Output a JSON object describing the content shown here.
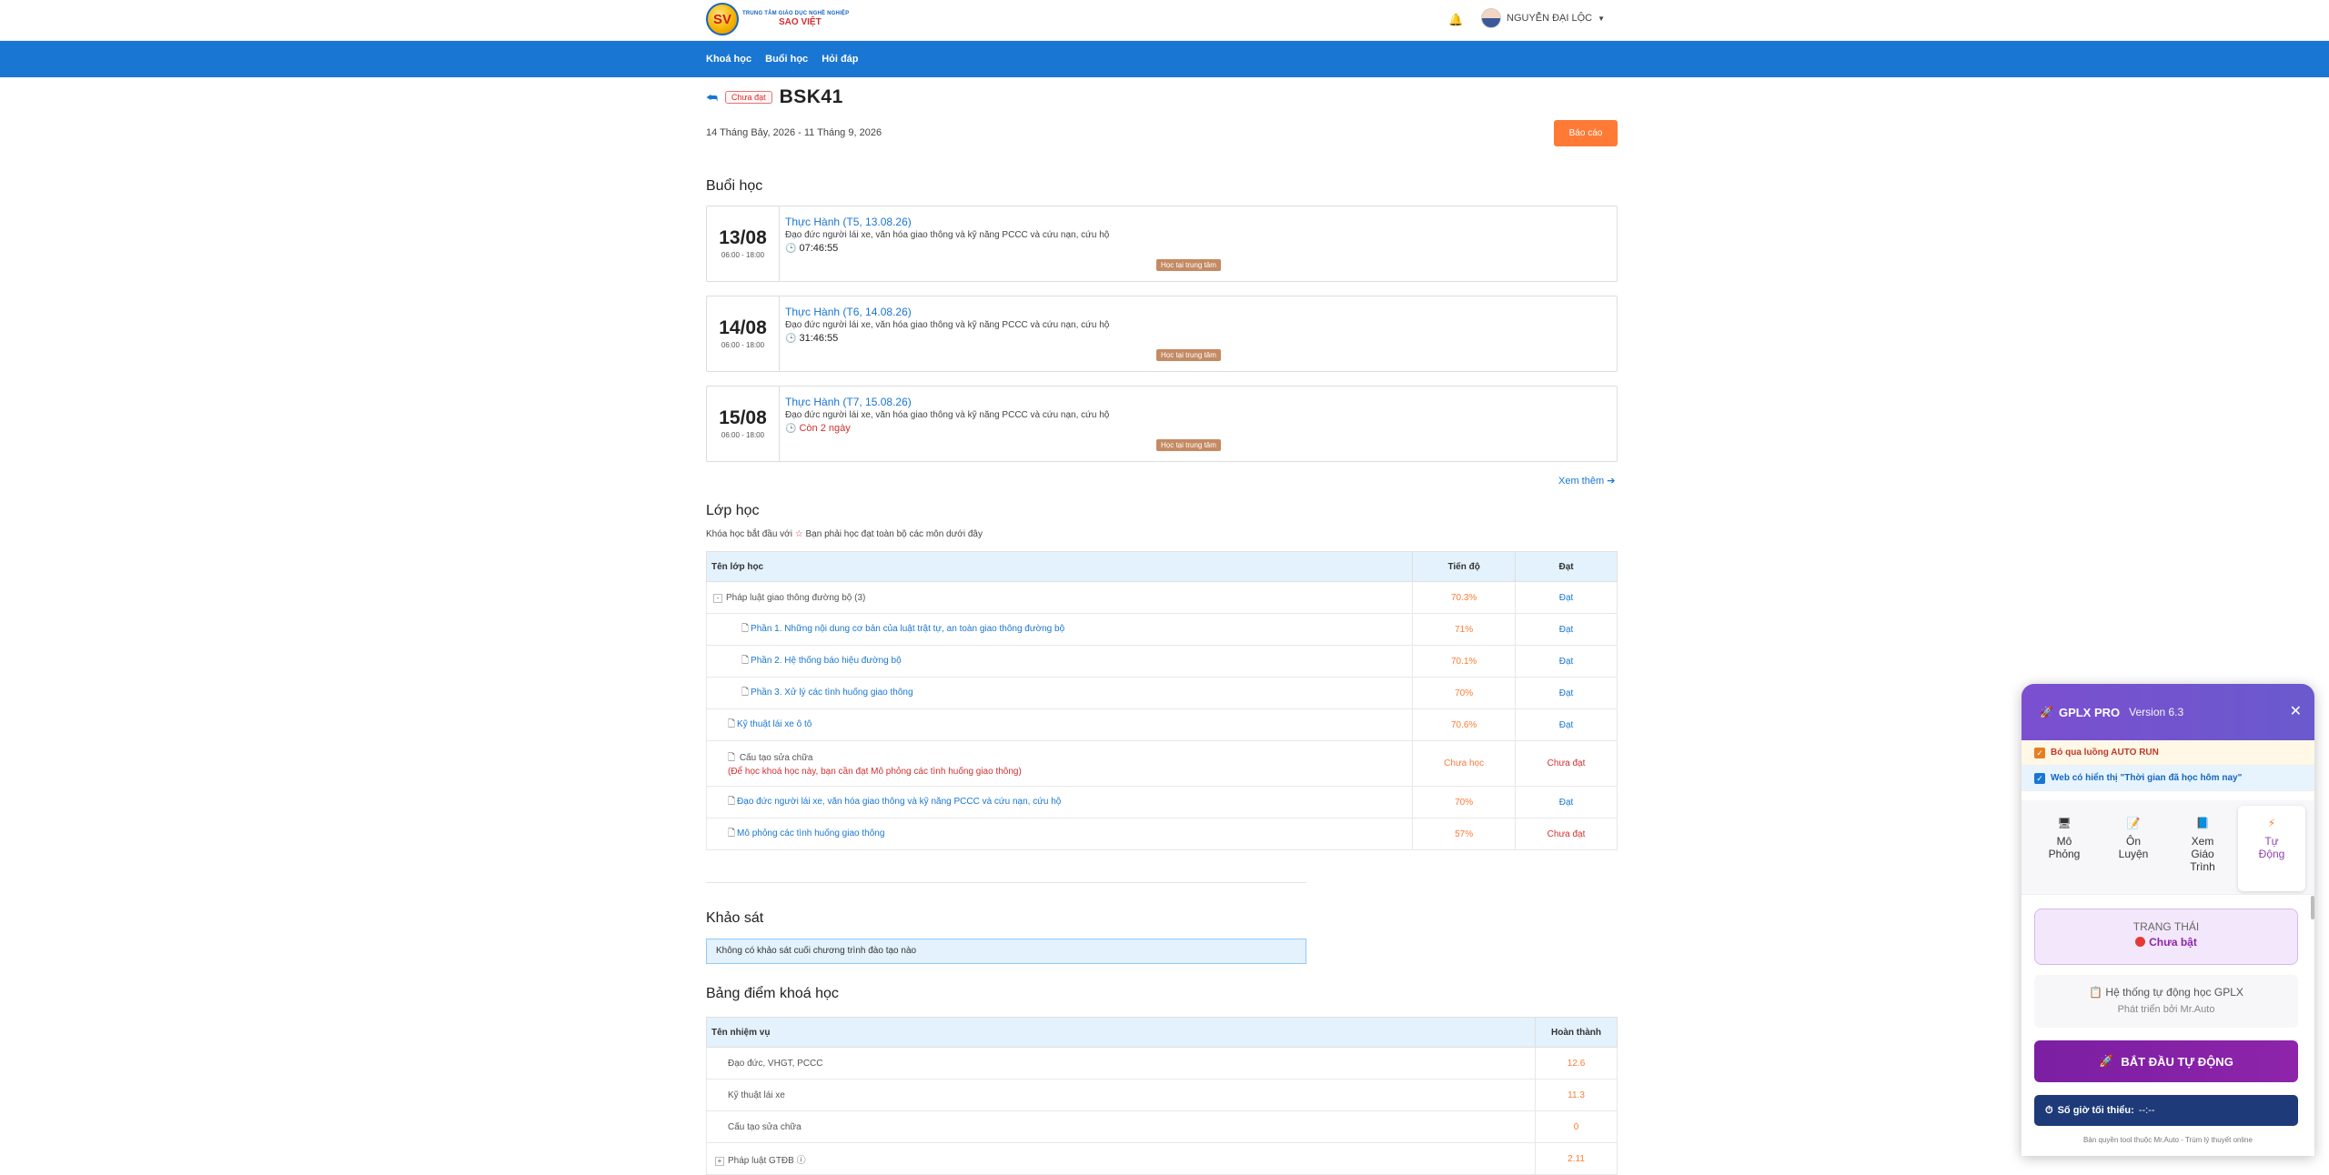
{
  "header": {
    "logo_line1": "TRUNG TÂM GIÁO DỤC NGHỀ NGHIỆP",
    "logo_line2": "SAO VIỆT",
    "logo_badge": "SV",
    "user_name": "NGUYỄN ĐẠI LỘC"
  },
  "nav": {
    "items": [
      "Khoá học",
      "Buổi học",
      "Hỏi đáp"
    ]
  },
  "course": {
    "status_badge": "Chưa đạt",
    "title": "BSK41",
    "date_range": "14 Tháng Bảy, 2026 - 11 Tháng 9, 2026",
    "report_button": "Báo cáo"
  },
  "sessions": {
    "heading": "Buổi học",
    "see_more": "Xem thêm",
    "items": [
      {
        "day": "13/08",
        "time": "06:00 - 18:00",
        "name": "Thực Hành (T5, 13.08.26)",
        "desc": "Đạo đức người lái xe, văn hóa giao thông và kỹ năng PCCC và cứu nạn, cứu hộ",
        "timer": "07:46:55",
        "tag": "Học tại trung tâm",
        "timer_color": "normal"
      },
      {
        "day": "14/08",
        "time": "06:00 - 18:00",
        "name": "Thực Hành (T6, 14.08.26)",
        "desc": "Đạo đức người lái xe, văn hóa giao thông và kỹ năng PCCC và cứu nạn, cứu hộ",
        "timer": "31:46:55",
        "tag": "Học tại trung tâm",
        "timer_color": "normal"
      },
      {
        "day": "15/08",
        "time": "06:00 - 18:00",
        "name": "Thực Hành (T7, 15.08.26)",
        "desc": "Đạo đức người lái xe, văn hóa giao thông và kỹ năng PCCC và cứu nạn, cứu hộ",
        "timer": "Còn 2 ngày",
        "tag": "Học tại trung tâm",
        "timer_color": "red"
      }
    ]
  },
  "classes": {
    "heading": "Lớp học",
    "note_pre": "Khóa học bắt đầu với",
    "note_post": "Bạn phải học đạt toàn bộ các môn dưới đây",
    "col_name": "Tên lớp học",
    "col_progress": "Tiến độ",
    "col_pass": "Đạt",
    "rows": [
      {
        "name": "Pháp luật giao thông đường bộ",
        "count": "(3)",
        "progress": "70.3%",
        "pass": "Đạt"
      },
      {
        "name": "Phần 1. Những nội dung cơ bản của luật trật tự, an toàn giao thông đường bộ",
        "progress": "71%",
        "pass": "Đạt"
      },
      {
        "name": "Phần 2. Hệ thống báo hiệu đường bộ",
        "progress": "70.1%",
        "pass": "Đạt"
      },
      {
        "name": "Phần 3. Xử lý các tình huống giao thông",
        "progress": "70%",
        "pass": "Đạt"
      },
      {
        "name": "Kỹ thuật lái xe ô tô",
        "progress": "70.6%",
        "pass": "Đạt"
      },
      {
        "name": "Cấu tạo sửa chữa",
        "warning": "(Để học khoá học này, bạn cần đạt Mô phỏng các tình huống giao thông)",
        "progress": "Chưa học",
        "pass": "Chưa đạt"
      },
      {
        "name": "Đạo đức người lái xe, văn hóa giao thông và kỹ năng PCCC và cứu nạn, cứu hộ",
        "progress": "70%",
        "pass": "Đạt"
      },
      {
        "name": "Mô phỏng các tình huống giao thông",
        "progress": "57%",
        "pass": "Chưa đạt"
      }
    ]
  },
  "survey": {
    "heading": "Khảo sát",
    "message": "Không có khảo sát cuối chương trình đào tạo nào"
  },
  "scores": {
    "heading": "Bảng điểm khoá học",
    "col_task": "Tên nhiệm vụ",
    "col_done": "Hoàn thành",
    "rows": [
      {
        "name": "Đạo đức, VHGT, PCCC",
        "value": "12.6"
      },
      {
        "name": "Kỹ thuật lái xe",
        "value": "11.3"
      },
      {
        "name": "Cấu tạo sửa chữa",
        "value": "0"
      },
      {
        "name": "Pháp luật GTĐB",
        "value": "2.11"
      }
    ]
  },
  "panel": {
    "title": "GPLX PRO",
    "version": "Version 6.3",
    "opt1": "Bỏ qua luồng AUTO RUN",
    "opt2": "Web có hiển thị \"Thời gian đã học hôm nay\"",
    "tabs": [
      {
        "label1": "Mô",
        "label2": "Phỏng",
        "label3": ""
      },
      {
        "label1": "Ôn",
        "label2": "Luyện",
        "label3": ""
      },
      {
        "label1": "Xem",
        "label2": "Giáo",
        "label3": "Trình"
      },
      {
        "label1": "Tự",
        "label2": "Động",
        "label3": ""
      }
    ],
    "status_label": "TRẠNG THÁI",
    "status_value": "Chưa bật",
    "sys_line1": "Hệ thống tự động học GPLX",
    "sys_line2": "Phát triển bởi Mr.Auto",
    "start_button": "BẮT ĐẦU TỰ ĐỘNG",
    "hours_label": "Số giờ tối thiểu:",
    "hours_value": "--:--",
    "copyright": "Bản quyền tool thuộc Mr.Auto - Trùm lý thuyết online"
  }
}
